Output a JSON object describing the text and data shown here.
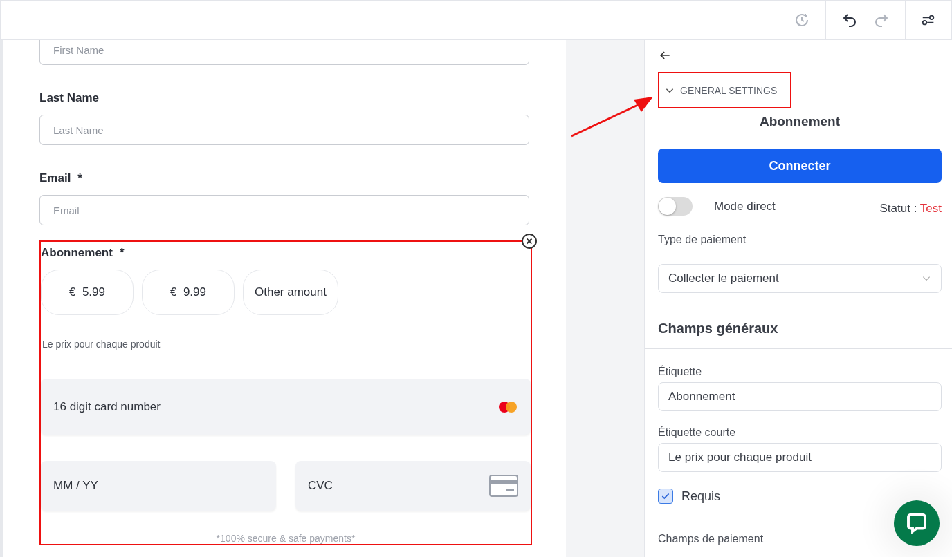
{
  "toolbar": {
    "history_disabled": true,
    "undo_disabled": false,
    "redo_disabled": true
  },
  "form": {
    "fields": [
      {
        "placeholder": "First Name"
      },
      {
        "label": "Last Name",
        "placeholder": "Last Name"
      },
      {
        "label": "Email",
        "required_mark": "*",
        "placeholder": "Email"
      }
    ],
    "subscription": {
      "label": "Abonnement",
      "required_mark": "*",
      "highlighted": true,
      "amounts": [
        {
          "currency": "€",
          "value": "5.99"
        },
        {
          "currency": "€",
          "value": "9.99"
        },
        {
          "value": "Other amount"
        }
      ],
      "hint": "Le prix pour chaque produit",
      "card_number": "16 digit card number",
      "expiry": "MM / YY",
      "cvc": "CVC",
      "secure_note": "*100% secure & safe payments*"
    }
  },
  "panel": {
    "section": {
      "label": "GENERAL SETTINGS",
      "expanded": true,
      "highlighted": true
    },
    "title": "Abonnement",
    "connect_button": "Connecter",
    "live_mode": {
      "label": "Mode direct",
      "on": false
    },
    "status": {
      "label": "Statut :",
      "value": "Test"
    },
    "payment_type": {
      "label": "Type de paiement",
      "value": "Collecter le paiement"
    },
    "general_heading": "Champs généraux",
    "label_field": {
      "label": "Étiquette",
      "value": "Abonnement"
    },
    "short_label_field": {
      "label": "Étiquette courte",
      "value": "Le prix pour chaque produit"
    },
    "required": {
      "label": "Requis",
      "checked": true
    },
    "payment_heading": "Champs de paiement"
  }
}
